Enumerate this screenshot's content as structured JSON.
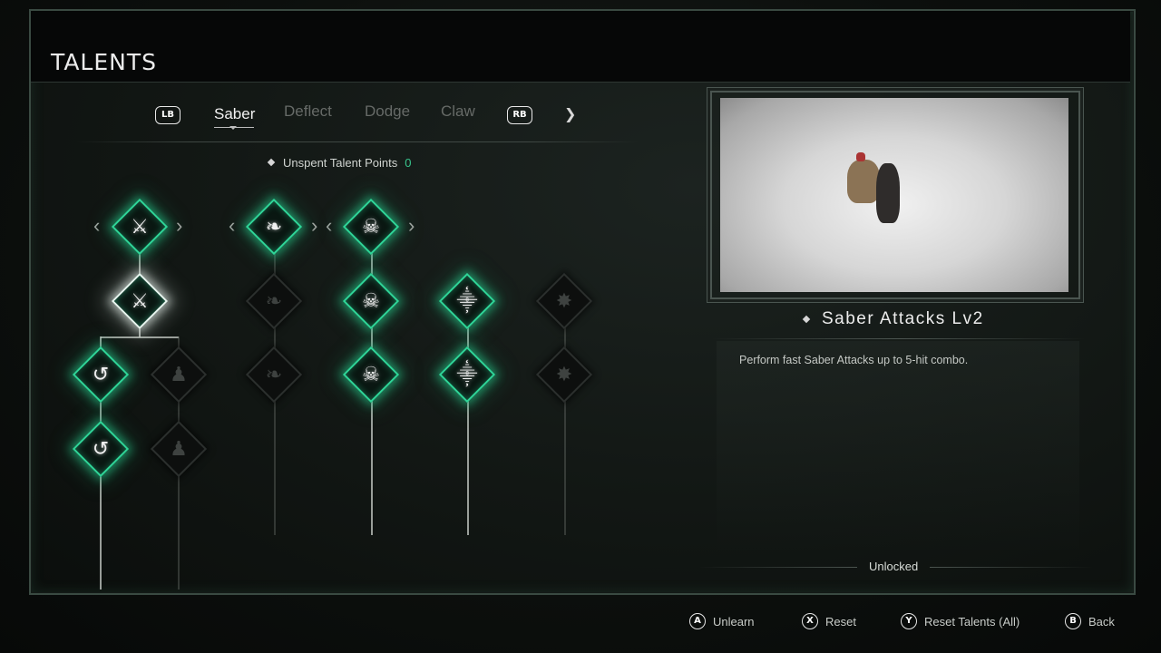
{
  "header": {
    "title": "TALENTS"
  },
  "tabs": {
    "left_bumper": "LB",
    "right_bumper": "RB",
    "items": [
      {
        "label": "Saber",
        "active": true
      },
      {
        "label": "Deflect",
        "active": false
      },
      {
        "label": "Dodge",
        "active": false
      },
      {
        "label": "Claw",
        "active": false
      }
    ],
    "next_icon": "chevron-right-icon"
  },
  "talent_points": {
    "label": "Unspent Talent Points",
    "value": "0"
  },
  "tree_icons": {
    "col1": [
      "saber-slash-icon",
      "saber-slash-icon",
      "swirl-slash-icon",
      "swirl-slash-icon"
    ],
    "col2": [
      "locked-figure-icon",
      "locked-figure-icon"
    ],
    "col3": [
      "claw-blade-icon",
      "claw-blade-icon",
      "claw-blade-icon"
    ],
    "col4": [
      "skull-dagger-icon",
      "skull-dagger-icon",
      "skull-dagger-icon"
    ],
    "col5": [
      "curved-sword-icon",
      "curved-sword-icon"
    ],
    "col6": [
      "pinwheel-icon",
      "pinwheel-icon"
    ]
  },
  "colors": {
    "accent": "#2fd598",
    "points": "#38c58d"
  },
  "detail": {
    "name": "Saber Attacks Lv2",
    "description": "Perform fast Saber Attacks up to 5-hit combo.",
    "status": "Unlocked"
  },
  "footer": {
    "prompts": [
      {
        "key": "A",
        "label": "Unlearn"
      },
      {
        "key": "X",
        "label": "Reset"
      },
      {
        "key": "Y",
        "label": "Reset Talents (All)"
      },
      {
        "key": "B",
        "label": "Back"
      }
    ]
  }
}
